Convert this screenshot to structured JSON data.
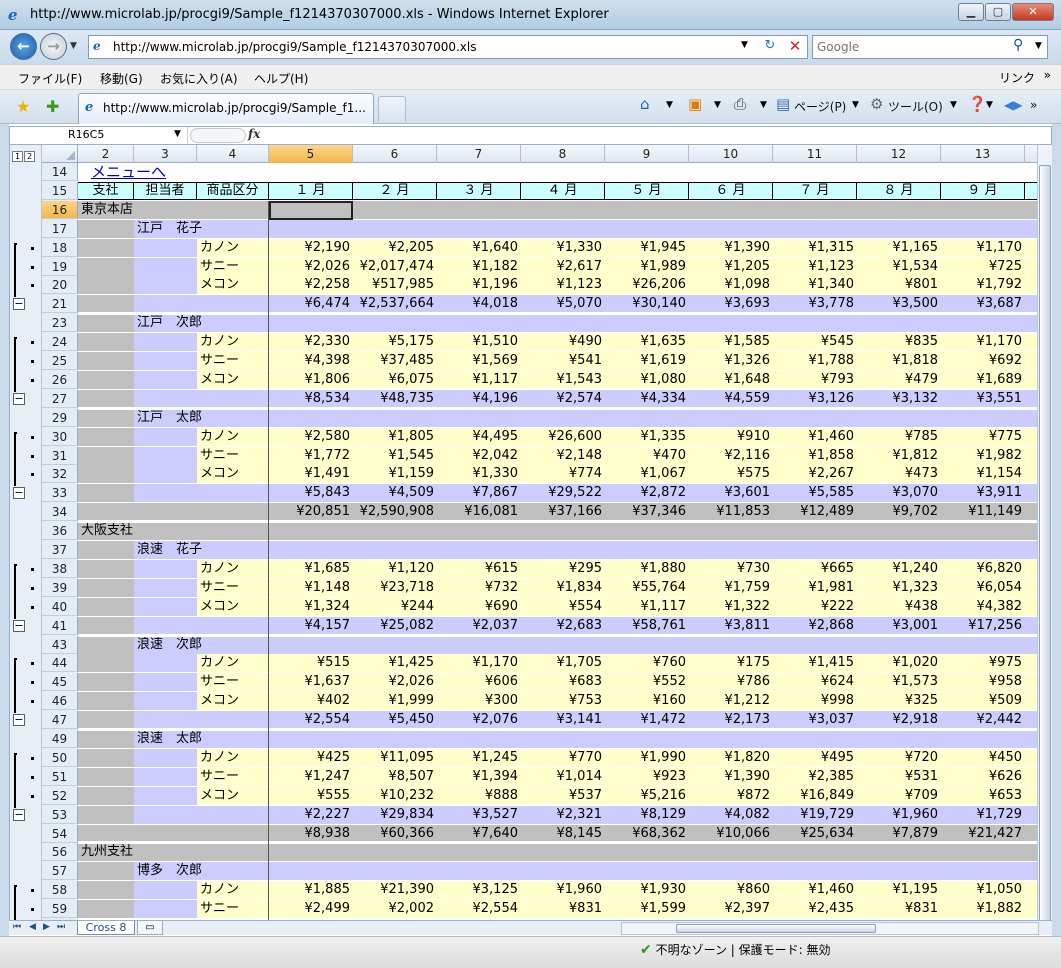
{
  "window": {
    "title": "http://www.microlab.jp/procgi9/Sample_f1214370307000.xls - Windows Internet Explorer",
    "url": "http://www.microlab.jp/procgi9/Sample_f1214370307000.xls",
    "search_placeholder": "Google",
    "tab_title": "http://www.microlab.jp/procgi9/Sample_f1...",
    "menu": [
      "ファイル(F)",
      "移動(G)",
      "お気に入り(A)",
      "ヘルプ(H)"
    ],
    "links_label": "リンク",
    "page_menu": "ページ(P)",
    "tools_menu": "ツール(O)",
    "status_zone": "不明なゾーン | 保護モード: 無効"
  },
  "sheet": {
    "name_box": "R16C5",
    "sheet_tab": "Cross 8",
    "level_buttons": [
      "1",
      "2"
    ],
    "columns": [
      "2",
      "3",
      "4",
      "5",
      "6",
      "7",
      "8",
      "9",
      "10",
      "11",
      "12",
      "13"
    ],
    "menu_link": "メニューへ",
    "headers": [
      "支社",
      "担当者",
      "商品区分",
      "１ 月",
      "２ 月",
      "３ 月",
      "４ 月",
      "５ 月",
      "６ 月",
      "７ 月",
      "８ 月",
      "９ 月"
    ],
    "rows": [
      {
        "r": "16",
        "kind": "branch",
        "label": "東京本店"
      },
      {
        "r": "17",
        "kind": "person",
        "label": "江戸　花子"
      },
      {
        "r": "18",
        "kind": "item",
        "label": "カノン",
        "v": [
          "¥2,190",
          "¥2,205",
          "¥1,640",
          "¥1,330",
          "¥1,945",
          "¥1,390",
          "¥1,315",
          "¥1,165",
          "¥1,170"
        ]
      },
      {
        "r": "19",
        "kind": "item",
        "label": "サニー",
        "v": [
          "¥2,026",
          "¥2,017,474",
          "¥1,182",
          "¥2,617",
          "¥1,989",
          "¥1,205",
          "¥1,123",
          "¥1,534",
          "¥725"
        ]
      },
      {
        "r": "20",
        "kind": "item",
        "label": "メコン",
        "v": [
          "¥2,258",
          "¥517,985",
          "¥1,196",
          "¥1,123",
          "¥26,206",
          "¥1,098",
          "¥1,340",
          "¥801",
          "¥1,792"
        ]
      },
      {
        "r": "21",
        "kind": "subtotal",
        "v": [
          "¥6,474",
          "¥2,537,664",
          "¥4,018",
          "¥5,070",
          "¥30,140",
          "¥3,693",
          "¥3,778",
          "¥3,500",
          "¥3,687"
        ]
      },
      {
        "r": "23",
        "kind": "person",
        "label": "江戸　次郎"
      },
      {
        "r": "24",
        "kind": "item",
        "label": "カノン",
        "v": [
          "¥2,330",
          "¥5,175",
          "¥1,510",
          "¥490",
          "¥1,635",
          "¥1,585",
          "¥545",
          "¥835",
          "¥1,170"
        ]
      },
      {
        "r": "25",
        "kind": "item",
        "label": "サニー",
        "v": [
          "¥4,398",
          "¥37,485",
          "¥1,569",
          "¥541",
          "¥1,619",
          "¥1,326",
          "¥1,788",
          "¥1,818",
          "¥692"
        ]
      },
      {
        "r": "26",
        "kind": "item",
        "label": "メコン",
        "v": [
          "¥1,806",
          "¥6,075",
          "¥1,117",
          "¥1,543",
          "¥1,080",
          "¥1,648",
          "¥793",
          "¥479",
          "¥1,689"
        ]
      },
      {
        "r": "27",
        "kind": "subtotal",
        "v": [
          "¥8,534",
          "¥48,735",
          "¥4,196",
          "¥2,574",
          "¥4,334",
          "¥4,559",
          "¥3,126",
          "¥3,132",
          "¥3,551"
        ]
      },
      {
        "r": "29",
        "kind": "person",
        "label": "江戸　太郎"
      },
      {
        "r": "30",
        "kind": "item",
        "label": "カノン",
        "v": [
          "¥2,580",
          "¥1,805",
          "¥4,495",
          "¥26,600",
          "¥1,335",
          "¥910",
          "¥1,460",
          "¥785",
          "¥775"
        ]
      },
      {
        "r": "31",
        "kind": "item",
        "label": "サニー",
        "v": [
          "¥1,772",
          "¥1,545",
          "¥2,042",
          "¥2,148",
          "¥470",
          "¥2,116",
          "¥1,858",
          "¥1,812",
          "¥1,982"
        ]
      },
      {
        "r": "32",
        "kind": "item",
        "label": "メコン",
        "v": [
          "¥1,491",
          "¥1,159",
          "¥1,330",
          "¥774",
          "¥1,067",
          "¥575",
          "¥2,267",
          "¥473",
          "¥1,154"
        ]
      },
      {
        "r": "33",
        "kind": "subtotal",
        "v": [
          "¥5,843",
          "¥4,509",
          "¥7,867",
          "¥29,522",
          "¥2,872",
          "¥3,601",
          "¥5,585",
          "¥3,070",
          "¥3,911"
        ]
      },
      {
        "r": "34",
        "kind": "total",
        "v": [
          "¥20,851",
          "¥2,590,908",
          "¥16,081",
          "¥37,166",
          "¥37,346",
          "¥11,853",
          "¥12,489",
          "¥9,702",
          "¥11,149"
        ]
      },
      {
        "r": "36",
        "kind": "branch",
        "label": "大阪支社"
      },
      {
        "r": "37",
        "kind": "person",
        "label": "浪速　花子"
      },
      {
        "r": "38",
        "kind": "item",
        "label": "カノン",
        "v": [
          "¥1,685",
          "¥1,120",
          "¥615",
          "¥295",
          "¥1,880",
          "¥730",
          "¥665",
          "¥1,240",
          "¥6,820"
        ]
      },
      {
        "r": "39",
        "kind": "item",
        "label": "サニー",
        "v": [
          "¥1,148",
          "¥23,718",
          "¥732",
          "¥1,834",
          "¥55,764",
          "¥1,759",
          "¥1,981",
          "¥1,323",
          "¥6,054"
        ]
      },
      {
        "r": "40",
        "kind": "item",
        "label": "メコン",
        "v": [
          "¥1,324",
          "¥244",
          "¥690",
          "¥554",
          "¥1,117",
          "¥1,322",
          "¥222",
          "¥438",
          "¥4,382"
        ]
      },
      {
        "r": "41",
        "kind": "subtotal",
        "v": [
          "¥4,157",
          "¥25,082",
          "¥2,037",
          "¥2,683",
          "¥58,761",
          "¥3,811",
          "¥2,868",
          "¥3,001",
          "¥17,256"
        ]
      },
      {
        "r": "43",
        "kind": "person",
        "label": "浪速　次郎"
      },
      {
        "r": "44",
        "kind": "item",
        "label": "カノン",
        "v": [
          "¥515",
          "¥1,425",
          "¥1,170",
          "¥1,705",
          "¥760",
          "¥175",
          "¥1,415",
          "¥1,020",
          "¥975"
        ]
      },
      {
        "r": "45",
        "kind": "item",
        "label": "サニー",
        "v": [
          "¥1,637",
          "¥2,026",
          "¥606",
          "¥683",
          "¥552",
          "¥786",
          "¥624",
          "¥1,573",
          "¥958"
        ]
      },
      {
        "r": "46",
        "kind": "item",
        "label": "メコン",
        "v": [
          "¥402",
          "¥1,999",
          "¥300",
          "¥753",
          "¥160",
          "¥1,212",
          "¥998",
          "¥325",
          "¥509"
        ]
      },
      {
        "r": "47",
        "kind": "subtotal",
        "v": [
          "¥2,554",
          "¥5,450",
          "¥2,076",
          "¥3,141",
          "¥1,472",
          "¥2,173",
          "¥3,037",
          "¥2,918",
          "¥2,442"
        ]
      },
      {
        "r": "49",
        "kind": "person",
        "label": "浪速　太郎"
      },
      {
        "r": "50",
        "kind": "item",
        "label": "カノン",
        "v": [
          "¥425",
          "¥11,095",
          "¥1,245",
          "¥770",
          "¥1,990",
          "¥1,820",
          "¥495",
          "¥720",
          "¥450"
        ]
      },
      {
        "r": "51",
        "kind": "item",
        "label": "サニー",
        "v": [
          "¥1,247",
          "¥8,507",
          "¥1,394",
          "¥1,014",
          "¥923",
          "¥1,390",
          "¥2,385",
          "¥531",
          "¥626"
        ]
      },
      {
        "r": "52",
        "kind": "item",
        "label": "メコン",
        "v": [
          "¥555",
          "¥10,232",
          "¥888",
          "¥537",
          "¥5,216",
          "¥872",
          "¥16,849",
          "¥709",
          "¥653"
        ]
      },
      {
        "r": "53",
        "kind": "subtotal",
        "v": [
          "¥2,227",
          "¥29,834",
          "¥3,527",
          "¥2,321",
          "¥8,129",
          "¥4,082",
          "¥19,729",
          "¥1,960",
          "¥1,729"
        ]
      },
      {
        "r": "54",
        "kind": "total",
        "v": [
          "¥8,938",
          "¥60,366",
          "¥7,640",
          "¥8,145",
          "¥68,362",
          "¥10,066",
          "¥25,634",
          "¥7,879",
          "¥21,427"
        ]
      },
      {
        "r": "56",
        "kind": "branch",
        "label": "九州支社"
      },
      {
        "r": "57",
        "kind": "person",
        "label": "博多　次郎"
      },
      {
        "r": "58",
        "kind": "item",
        "label": "カノン",
        "v": [
          "¥1,885",
          "¥21,390",
          "¥3,125",
          "¥1,960",
          "¥1,930",
          "¥860",
          "¥1,460",
          "¥1,195",
          "¥1,050"
        ]
      },
      {
        "r": "59",
        "kind": "item",
        "label": "サニー",
        "v": [
          "¥2,499",
          "¥2,002",
          "¥2,554",
          "¥831",
          "¥1,599",
          "¥2,397",
          "¥2,435",
          "¥831",
          "¥1,882"
        ]
      }
    ]
  },
  "colors": {
    "branch_bg": "#c0c0c0",
    "person_bg": "#ccccff",
    "item_bg": "#ffffcc",
    "header_bg": "#ccffff",
    "link_color": "#0000cc"
  }
}
